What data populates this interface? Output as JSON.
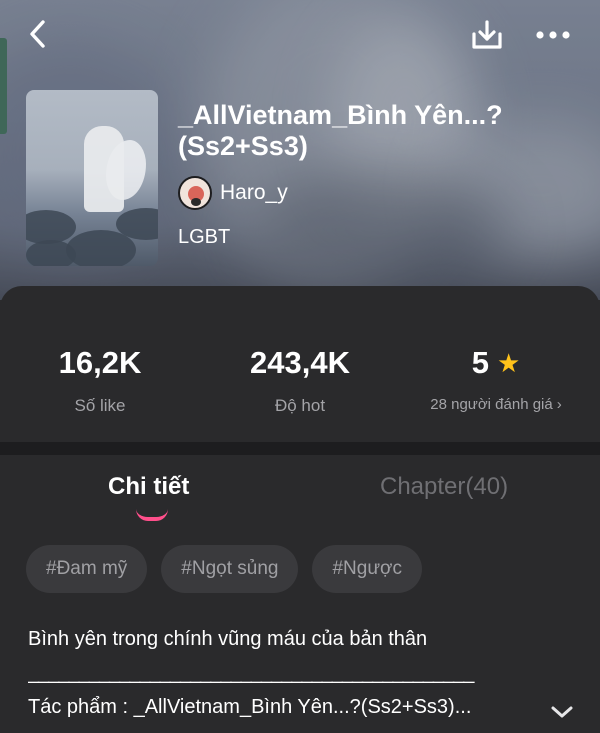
{
  "header": {
    "back_icon": "chevron-left-icon",
    "download_icon": "download-icon",
    "more_icon": "more-horizontal-icon"
  },
  "book": {
    "title": "_AllVietnam_Bình Yên...?(Ss2+Ss3)",
    "author": "Haro_y",
    "category": "LGBT"
  },
  "stats": {
    "likes_value": "16,2K",
    "likes_label": "Số like",
    "hot_value": "243,4K",
    "hot_label": "Độ hot",
    "rating_value": "5",
    "rating_label": "28 người đánh giá",
    "star_color": "#ffc21a"
  },
  "tabs": {
    "detail": "Chi tiết",
    "chapter": "Chapter(40)",
    "accent_color": "#ff4f8b"
  },
  "tags": [
    "#Đam mỹ",
    "#Ngọt sủng",
    "#Ngược"
  ],
  "description": {
    "line1": "Bình yên trong chính vũng máu của bản thân",
    "line2": "____________________________________________",
    "line3": "Tác phẩm : _AllVietnam_Bình Yên...?(Ss2+Ss3)..."
  }
}
